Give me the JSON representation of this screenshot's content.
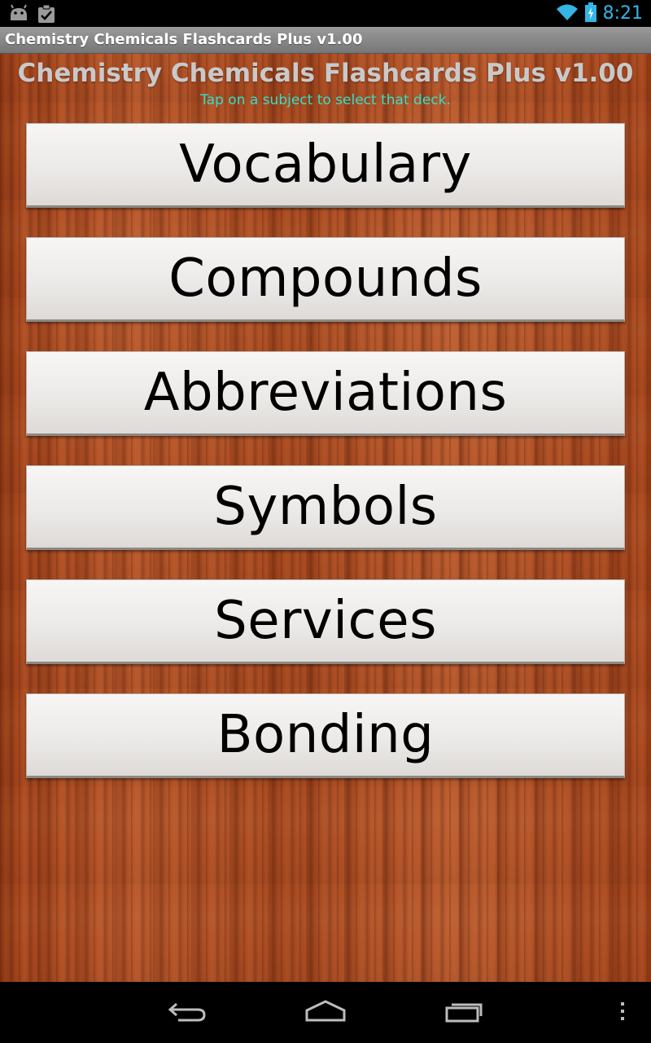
{
  "status_bar": {
    "time": "8:21",
    "icons": [
      "android-icon",
      "clipboard-check-icon",
      "wifi-icon",
      "battery-charging-icon"
    ]
  },
  "title_bar": {
    "title": "Chemistry Chemicals Flashcards Plus v1.00"
  },
  "main": {
    "heading": "Chemistry Chemicals Flashcards Plus v1.00",
    "subtitle": "Tap on a subject to select that deck.",
    "decks": [
      {
        "label": "Vocabulary"
      },
      {
        "label": "Compounds"
      },
      {
        "label": "Abbreviations"
      },
      {
        "label": "Symbols"
      },
      {
        "label": "Services"
      },
      {
        "label": "Bonding"
      }
    ]
  },
  "nav_bar": {
    "icons": [
      "back-icon",
      "home-icon",
      "recent-apps-icon",
      "overflow-menu-icon"
    ]
  },
  "colors": {
    "status_accent": "#33b5e5",
    "subtitle": "#33e0c8",
    "heading": "#c9c9c9",
    "wood": "#a8481f"
  }
}
